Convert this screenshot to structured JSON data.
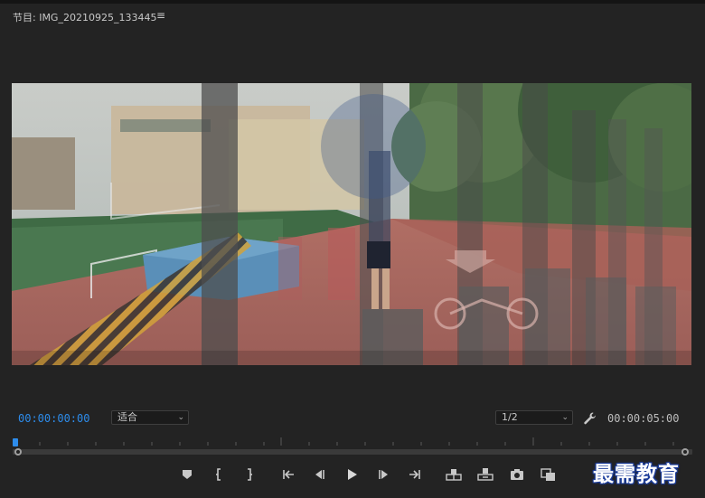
{
  "panel": {
    "title": "节目: IMG_20210925_133445",
    "menu_icon": "hamburger-icon"
  },
  "monitor": {
    "current_timecode": "00:00:00:00",
    "duration_timecode": "00:00:05:00",
    "fit_dropdown": "适合",
    "resolution_dropdown": "1/2",
    "settings_icon": "wrench-icon"
  },
  "transport": {
    "buttons": [
      "add-marker-icon",
      "mark-in-icon",
      "mark-out-icon",
      "go-to-in-icon",
      "step-back-icon",
      "play-icon",
      "step-forward-icon",
      "go-to-out-icon",
      "lift-icon",
      "extract-icon",
      "export-frame-icon",
      "compare-view-icon"
    ]
  },
  "watermark": "最需教育",
  "colors": {
    "accent": "#2d8ceb",
    "panel_bg": "#232323"
  }
}
